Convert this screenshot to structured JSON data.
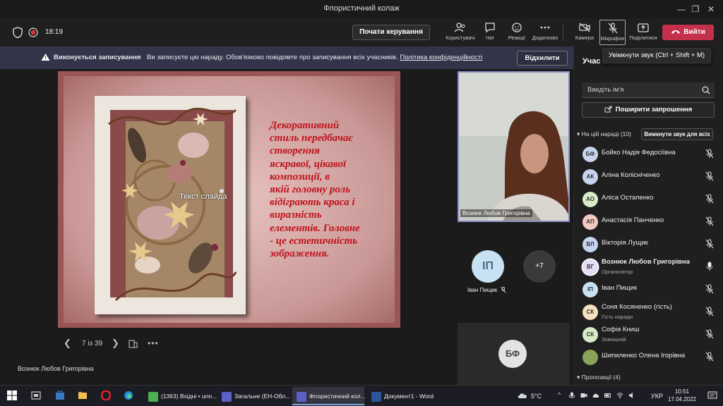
{
  "window": {
    "title": "Флористичний колаж"
  },
  "toolbar": {
    "time": "18:19",
    "control_button": "Почати керування",
    "people_label": "Користувачі",
    "chat_label": "Чат",
    "reactions_label": "Реакції",
    "more_label": "Додатково",
    "camera_label": "Камера",
    "mic_label": "Мікрофон",
    "share_label": "Поділитися",
    "leave_button": "Вийти"
  },
  "banner": {
    "title": "Виконується записування",
    "message": "Ви записуєте цю нараду. Обов'язково повідомте про записування всіх учасників.",
    "link": "Політика конфіденційності",
    "dismiss_button": "Відхилити"
  },
  "tooltip": "Увімкнути звук (Ctrl + Shift + M)",
  "slide": {
    "text": "Декоративний\nстиль передбачає\nстворення\nяскравої, цікавої\nкомпозиції, в\nякій  головну роль\nвідіграють краса і\nвиразність\nелементів. Головне\n- це естетичність\nзображення.",
    "placeholder": "Текст слайда",
    "counter": "7 із 39"
  },
  "presenter": "Вознюк Любов Григорівна",
  "video_label": "Вознюк Любов Григорівна",
  "gallery": {
    "ip_initials": "ІП",
    "ip_name": "Іван Пищик",
    "more_count": "+7",
    "bf_initials": "БФ"
  },
  "panel": {
    "title": "Учас",
    "search_placeholder": "Введіть ім'я",
    "share_invite": "Поширити запрошення",
    "section_label": "На цій нараді (10)",
    "mute_all": "Вимкнути звук для всіх",
    "proposals_label": "Пропозиції (4)",
    "participants": [
      {
        "initials": "БФ",
        "name": "Бойко Надія Федосіївна",
        "sub": "",
        "color": "#c7d4f0"
      },
      {
        "initials": "АК",
        "name": "Аліна Колісніченко",
        "sub": "",
        "color": "#c7d4f0"
      },
      {
        "initials": "АО",
        "name": "Аліса Остапенко",
        "sub": "",
        "color": "#d6ecc6"
      },
      {
        "initials": "АП",
        "name": "Анастасія Панченко",
        "sub": "",
        "color": "#f2c8c0"
      },
      {
        "initials": "ВЛ",
        "name": "Вікторія Лущик",
        "sub": "",
        "color": "#c7d4f0"
      },
      {
        "initials": "ВГ",
        "name": "Вознюк Любов Григорівна",
        "sub": "Организатор",
        "color": "#e6ddf5"
      },
      {
        "initials": "ІП",
        "name": "Іван Пищик",
        "sub": "",
        "color": "#c7e2f5"
      },
      {
        "initials": "СК",
        "name": "Соня Косяненко (гість)",
        "sub": "Гість наради",
        "color": "#f5e0c0"
      },
      {
        "initials": "СК",
        "name": "Софія Книш",
        "sub": "Зовнішній",
        "color": "#d6ecc6"
      },
      {
        "initials": "",
        "name": "Шипиленко Олена Ігорівна",
        "sub": "",
        "color": "#8aa25a"
      }
    ]
  },
  "taskbar": {
    "apps": [
      {
        "label": "(1363) Вхідні • unn...",
        "color": "#4caf50"
      },
      {
        "label": "Загальне (ЕН-Обл...",
        "color": "#5b5fc7"
      },
      {
        "label": "Флористичний кол...",
        "color": "#5b5fc7"
      },
      {
        "label": "Документ1 - Word",
        "color": "#2b579a"
      }
    ],
    "weather": "5°C",
    "lang": "УКР",
    "time": "10:51",
    "date": "17.04.2022"
  }
}
